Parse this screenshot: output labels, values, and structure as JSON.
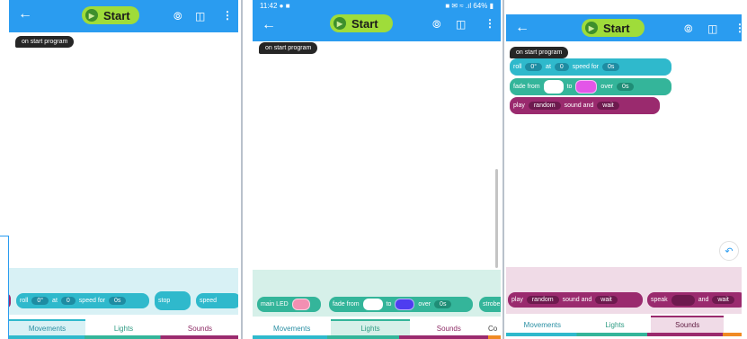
{
  "app": {
    "start_label": "Start"
  },
  "hat_label": "on start program",
  "status": {
    "time": "11:42",
    "battery": "64%"
  },
  "blocks": {
    "roll": {
      "label": "roll",
      "angle": "0°",
      "at": "at",
      "speed_value": "0",
      "speed_label": "speed for",
      "time_value": "0s"
    },
    "fade": {
      "label": "fade from",
      "to": "to",
      "over": "over",
      "time_value": "0s"
    },
    "play": {
      "label": "play",
      "sound": "random",
      "sound_and": "sound and",
      "wait": "wait"
    },
    "main_led": {
      "label": "main LED"
    },
    "stop": {
      "label": "stop"
    },
    "speed": {
      "label": "speed"
    },
    "speak": {
      "label": "speak",
      "and": "and",
      "wait": "wait"
    },
    "strobe": {
      "label": "strobe"
    }
  },
  "tabs": [
    {
      "label": "Movements"
    },
    {
      "label": "Lights"
    },
    {
      "label": "Sounds"
    },
    {
      "label": "Co"
    }
  ],
  "colors": {
    "appbar": "#2a9cf0",
    "start": "#9fdc3a",
    "movements": "#2fb9cc",
    "lights": "#34b59a",
    "sounds": "#9a2a6e",
    "fade_from_white": "#ffffff",
    "fade_to_magenta": "#e356e8",
    "fade_to_blue": "#4e3df0",
    "main_led_pink": "#f28fb2"
  }
}
